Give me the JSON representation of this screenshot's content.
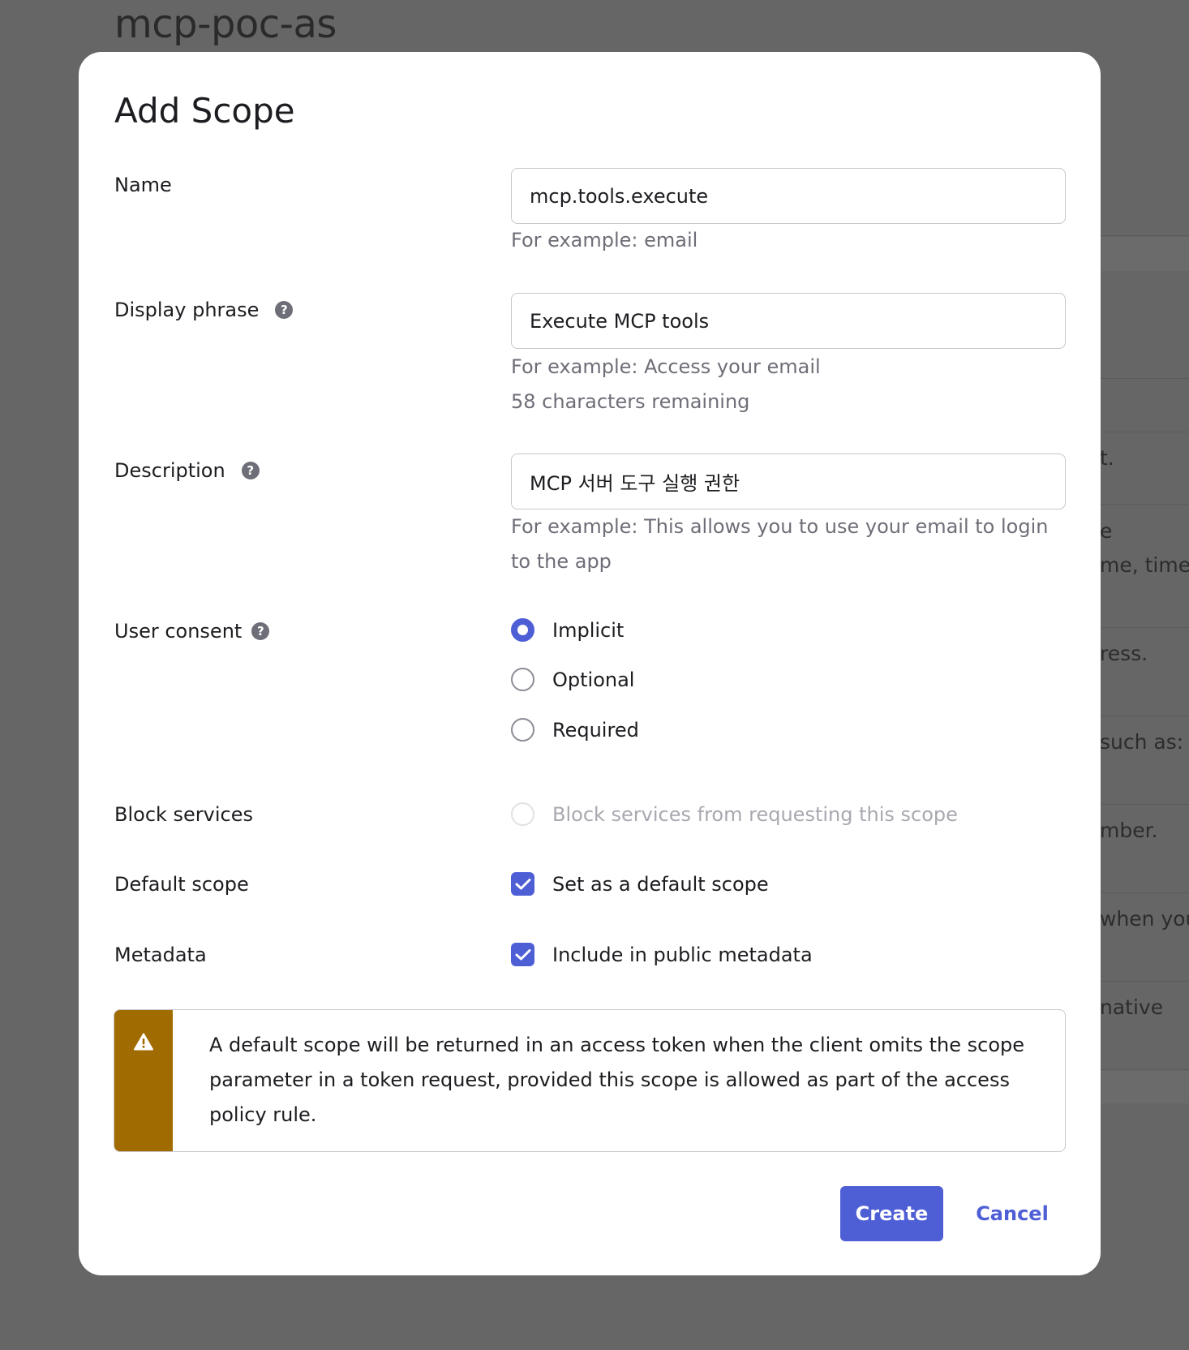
{
  "background": {
    "page_title": "mcp-poc-as",
    "fragments": [
      "t.",
      "e",
      "me, time",
      "ress.",
      "such as:",
      "mber.",
      "when you",
      "native"
    ]
  },
  "modal": {
    "title": "Add Scope",
    "name": {
      "label": "Name",
      "value": "mcp.tools.execute",
      "hint": "For example: email"
    },
    "display_phrase": {
      "label": "Display phrase",
      "value": "Execute MCP tools",
      "hint": "For example: Access your email",
      "remaining": "58 characters remaining"
    },
    "description": {
      "label": "Description",
      "value": "MCP 서버 도구 실행 권한",
      "hint": "For example: This allows you to use your email to login to the app"
    },
    "user_consent": {
      "label": "User consent",
      "options": [
        "Implicit",
        "Optional",
        "Required"
      ],
      "selected": "Implicit"
    },
    "block_services": {
      "label": "Block services",
      "option": "Block services from requesting this scope"
    },
    "default_scope": {
      "label": "Default scope",
      "option": "Set as a default scope",
      "checked": true
    },
    "metadata": {
      "label": "Metadata",
      "option": "Include in public metadata",
      "checked": true
    },
    "callout": {
      "text": "A default scope will be returned in an access token when the client omits the scope parameter in a token request, provided this scope is allowed as part of the access policy rule."
    },
    "buttons": {
      "create": "Create",
      "cancel": "Cancel"
    }
  },
  "colors": {
    "accent": "#4e5fd6",
    "warning": "#a06b00",
    "overlay": "#666666"
  }
}
